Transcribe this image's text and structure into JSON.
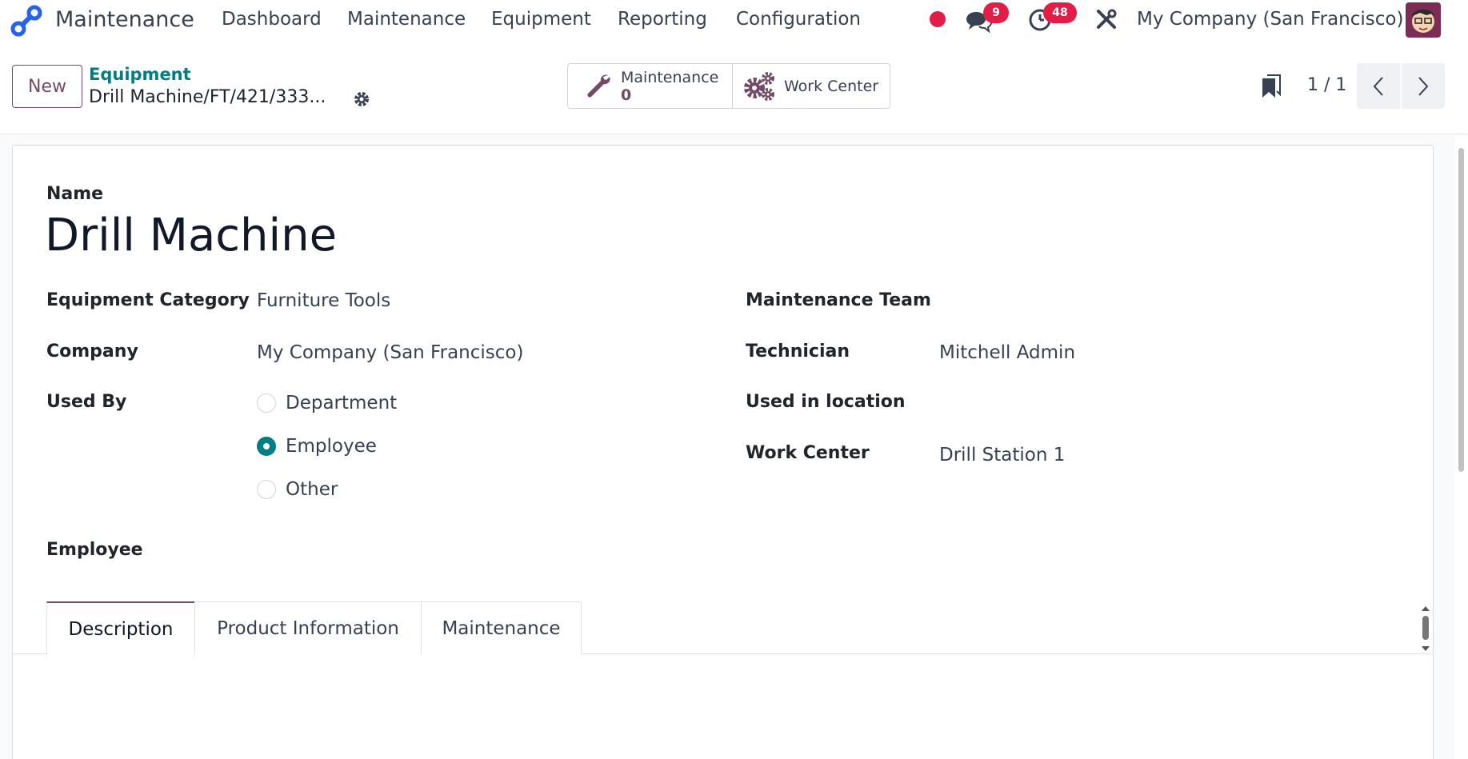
{
  "navbar": {
    "app_name": "Maintenance",
    "menus": [
      "Dashboard",
      "Maintenance",
      "Equipment",
      "Reporting",
      "Configuration"
    ],
    "messages_count": "9",
    "activities_count": "48",
    "company": "My Company (San Francisco)",
    "status_color": "#e11d48"
  },
  "control": {
    "new_label": "New",
    "breadcrumb_parent": "Equipment",
    "breadcrumb_current": "Drill Machine/FT/421/333...",
    "smart_buttons": [
      {
        "label": "Maintenance",
        "value": "0",
        "icon": "wrench-icon"
      },
      {
        "label": "Work Center",
        "icon": "gears-icon"
      }
    ],
    "pager": "1 / 1"
  },
  "form": {
    "name_label": "Name",
    "name_value": "Drill Machine",
    "left_fields": [
      {
        "label": "Equipment Category",
        "value": "Furniture Tools"
      },
      {
        "label": "Company",
        "value": "My Company (San Francisco)"
      },
      {
        "label": "Used By"
      }
    ],
    "used_by_options": [
      {
        "label": "Department",
        "checked": false
      },
      {
        "label": "Employee",
        "checked": true
      },
      {
        "label": "Other",
        "checked": false
      }
    ],
    "employee_label": "Employee",
    "right_fields": [
      {
        "label": "Maintenance Team",
        "value": ""
      },
      {
        "label": "Technician",
        "value": "Mitchell Admin"
      },
      {
        "label": "Used in location",
        "value": ""
      },
      {
        "label": "Work Center",
        "value": "Drill Station 1"
      }
    ]
  },
  "tabs": [
    "Description",
    "Product Information",
    "Maintenance"
  ],
  "colors": {
    "brand": "#714B67",
    "accent": "#017e84"
  }
}
